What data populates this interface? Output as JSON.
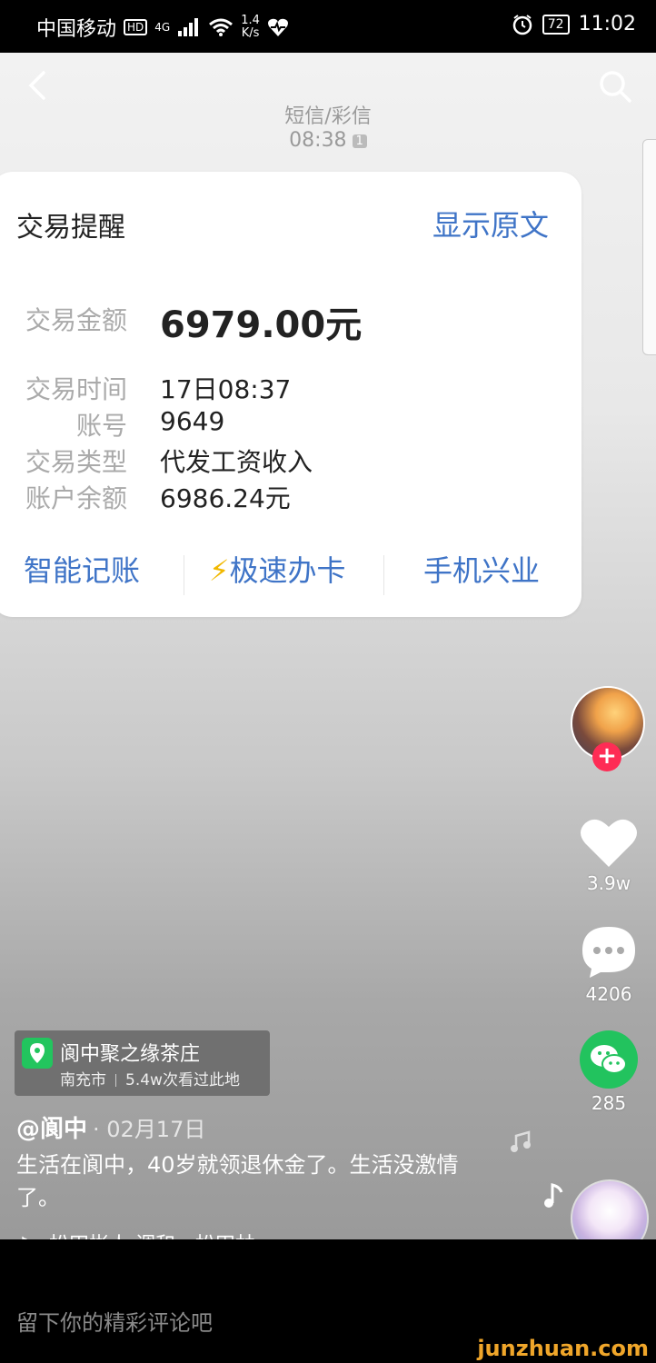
{
  "status_bar": {
    "carrier": "中国移动",
    "hd": "HD",
    "network": "4G",
    "speed_value": "1.4",
    "speed_unit": "K/s",
    "battery": "72",
    "time": "11:02"
  },
  "sms": {
    "source": "短信/彩信",
    "time": "08:38",
    "sim": "1"
  },
  "card": {
    "title": "交易提醒",
    "show_original": "显示原文",
    "rows": [
      {
        "label": "交易金额",
        "value": "6979.00元"
      },
      {
        "label": "交易时间",
        "value": "17日08:37"
      },
      {
        "label": "账号",
        "value": "9649"
      },
      {
        "label": "交易类型",
        "value": "代发工资收入"
      },
      {
        "label": "账户余额",
        "value": "6986.24元"
      }
    ],
    "actions": {
      "smart_bookkeeping": "智能记账",
      "bolt": "⚡",
      "fast_card": "极速办卡",
      "mobile_xingye": "手机兴业"
    }
  },
  "side": {
    "follow_plus": "+",
    "likes": "3.9w",
    "comments": "4206",
    "shares": "285"
  },
  "location": {
    "name": "阆中聚之缘茶庄",
    "city": "南充市",
    "visits": "5.4w次看过此地"
  },
  "post": {
    "author": "@阆中",
    "date": "· 02月17日",
    "caption": "生活在阆中，40岁就领退休金了。生活没激情了。",
    "music": "♪  -  松田彬人     调和  -  松田林"
  },
  "comment_placeholder": "留下你的精彩评论吧",
  "watermark": "junzhuan.com",
  "colors": {
    "link_blue": "#3f74c7",
    "follow_red": "#fe2c55",
    "wechat_green": "#22c35e",
    "watermark_orange": "#f0a62a"
  },
  "icons": [
    "back-icon",
    "search-icon",
    "heart-icon",
    "comment-icon",
    "wechat-icon",
    "location-pin-icon",
    "music-note-icon",
    "alarm-icon",
    "wifi-icon",
    "signal-icon",
    "health-icon"
  ]
}
